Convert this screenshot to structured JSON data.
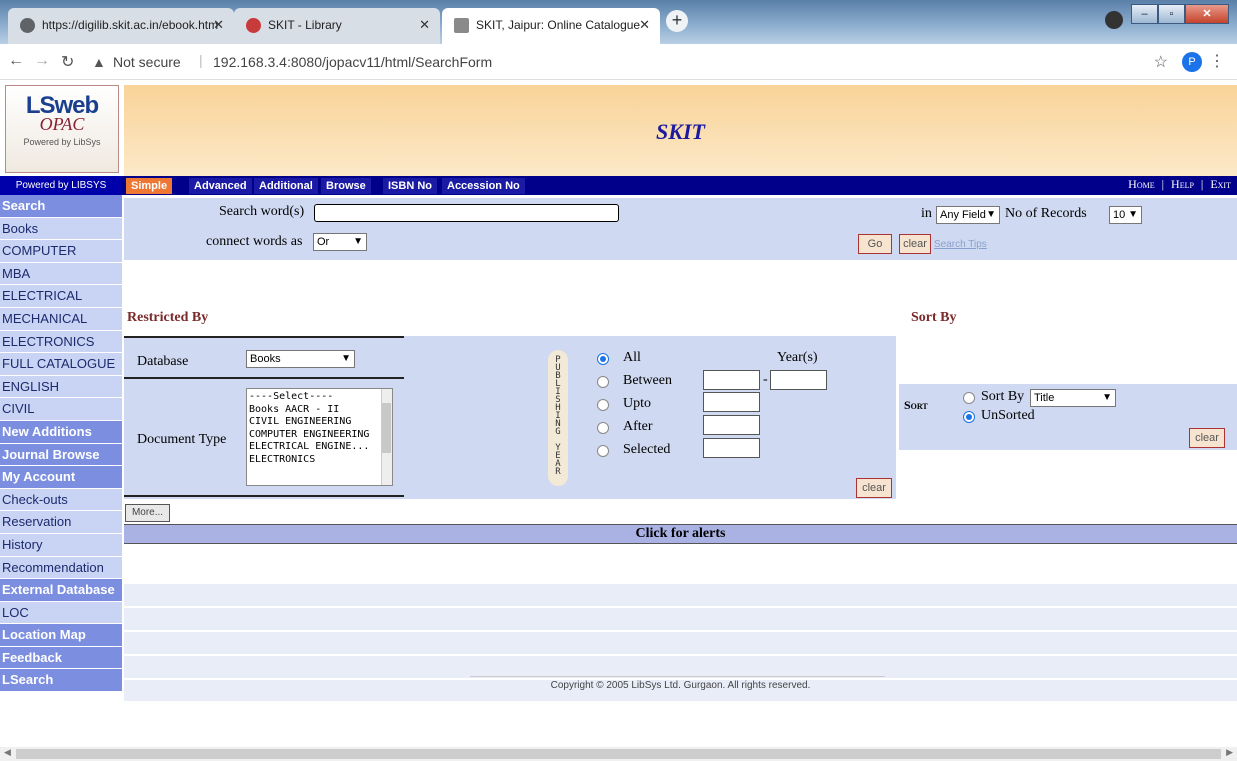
{
  "browser": {
    "tabs": [
      {
        "title": "https://digilib.skit.ac.in/ebook.htm",
        "active": false
      },
      {
        "title": "SKIT - Library",
        "active": false
      },
      {
        "title": "SKIT, Jaipur: Online Catalogue",
        "active": true
      }
    ],
    "new_tab": "+",
    "security": "Not secure",
    "url": "192.168.3.4:8080/jopacv11/html/SearchForm",
    "profile_initial": "P"
  },
  "logo": {
    "line1": "LSweb",
    "line2": "OPAC",
    "line3": "Powered by LibSys"
  },
  "banner": {
    "title": "SKIT"
  },
  "menubar": {
    "powered_by": "Powered by LIBSYS",
    "tabs": [
      "Simple",
      "Advanced",
      "Additional",
      "Browse",
      "ISBN No",
      "Accession No"
    ],
    "links": [
      "Home",
      "Help",
      "Exit"
    ]
  },
  "sidebar": {
    "items": [
      {
        "label": "Search",
        "type": "head"
      },
      {
        "label": "Books",
        "type": "link"
      },
      {
        "label": "COMPUTER",
        "type": "link"
      },
      {
        "label": "MBA",
        "type": "link"
      },
      {
        "label": "ELECTRICAL",
        "type": "link"
      },
      {
        "label": "MECHANICAL",
        "type": "link"
      },
      {
        "label": "ELECTRONICS",
        "type": "link"
      },
      {
        "label": "FULL CATALOGUE",
        "type": "link"
      },
      {
        "label": "ENGLISH",
        "type": "link"
      },
      {
        "label": "CIVIL",
        "type": "link"
      },
      {
        "label": "New Additions",
        "type": "head"
      },
      {
        "label": "Journal Browse",
        "type": "head"
      },
      {
        "label": "My Account",
        "type": "head"
      },
      {
        "label": "Check-outs",
        "type": "link"
      },
      {
        "label": "Reservation",
        "type": "link"
      },
      {
        "label": "History",
        "type": "link"
      },
      {
        "label": "Recommendation",
        "type": "link"
      },
      {
        "label": "External Database",
        "type": "head"
      },
      {
        "label": "LOC",
        "type": "link"
      },
      {
        "label": "Location Map",
        "type": "head"
      },
      {
        "label": "Feedback",
        "type": "head"
      },
      {
        "label": "LSearch",
        "type": "head"
      }
    ]
  },
  "search": {
    "word_label": "Search word(s)",
    "word_value": "",
    "connect_label": "connect words as",
    "connect_value": "Or",
    "in_label": "in",
    "field_value": "Any Field",
    "records_label": "No of Records",
    "records_value": "10",
    "go_label": "Go",
    "clear_label": "clear",
    "tips_label": "Search Tips"
  },
  "restricted": {
    "heading": "Restricted By",
    "database_label": "Database",
    "database_value": "Books",
    "doctype_label": "Document Type",
    "doctype_options": [
      "----Select----",
      "Books AACR - II",
      "CIVIL ENGINEERING",
      "COMPUTER ENGINEERING",
      "ELECTRICAL ENGINE...",
      "ELECTRONICS"
    ],
    "pub_year_letters": [
      "P",
      "U",
      "B",
      "L",
      "I",
      "S",
      "H",
      "I",
      "N",
      "G",
      " ",
      "Y",
      "E",
      "A",
      "R"
    ],
    "year_options": [
      {
        "label": "All",
        "selected": true
      },
      {
        "label": "Between",
        "selected": false
      },
      {
        "label": "Upto",
        "selected": false
      },
      {
        "label": "After",
        "selected": false
      },
      {
        "label": "Selected",
        "selected": false
      }
    ],
    "years_label": "Year(s)",
    "range_dash": "-",
    "clear_label": "clear",
    "more_label": "More..."
  },
  "sort": {
    "heading": "Sort By",
    "sort_label": "Sort",
    "sortby_label": "Sort By",
    "sortby_value": "Title",
    "unsorted_label": "UnSorted",
    "unsorted_selected": true,
    "clear_label": "clear"
  },
  "alerts": {
    "label": "Click for alerts"
  },
  "footer": {
    "copyright": "Copyright © 2005 LibSys Ltd. Gurgaon. All rights reserved."
  },
  "colors": {
    "banner": "#f9d398",
    "menubar": "#00008b",
    "panel": "#cfd9f1",
    "sidebar_head": "#7b8ee0",
    "active_tab": "#ee7733"
  }
}
